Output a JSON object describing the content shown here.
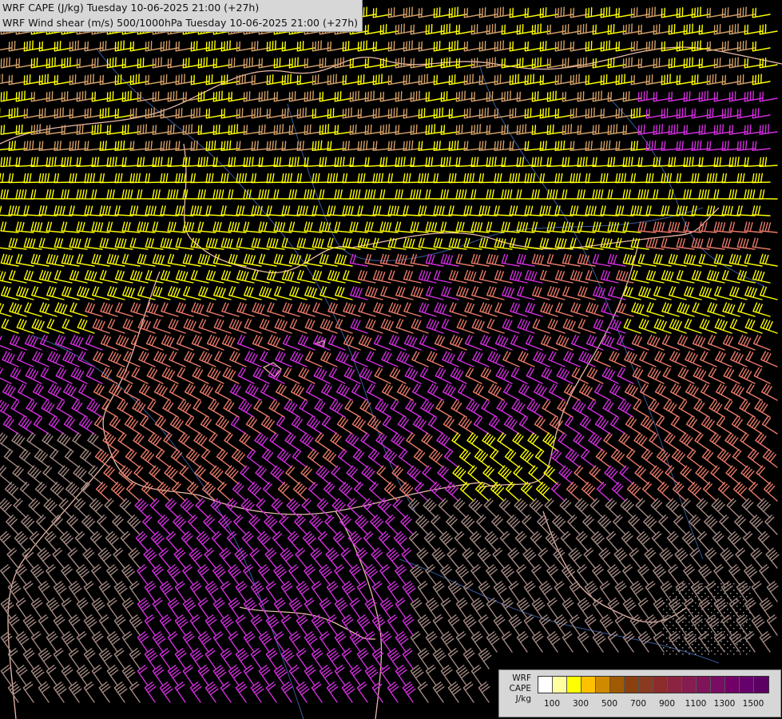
{
  "header": {
    "line1": "WRF CAPE (J/kg) Tuesday 10-06-2025 21:00 (+27h)",
    "line2": "WRF Wind shear (m/s) 500/1000hPa Tuesday 10-06-2025 21:00 (+27h)"
  },
  "legend": {
    "title_line1": "WRF",
    "title_line2": "CAPE",
    "unit": "J/kg",
    "tick_labels": [
      "100",
      "300",
      "500",
      "700",
      "900",
      "1100",
      "1300",
      "1500"
    ],
    "colors": [
      "#ffffff",
      "#ffffa0",
      "#ffff00",
      "#ffc000",
      "#d08a00",
      "#a05a00",
      "#8b4010",
      "#8a3a20",
      "#8c2c2c",
      "#8a2440",
      "#861c50",
      "#80145a",
      "#7a0c64",
      "#720068",
      "#66006a",
      "#5c0064"
    ]
  },
  "map_layers": {
    "barb_colors": {
      "low_cape": "#a58a83",
      "tan": "#d4a066",
      "yellow": "#ffff00",
      "salmon": "#ec7a6a",
      "magenta": "#d52ee0"
    },
    "border_color": "#e8b8a8",
    "river_color": "#3a5a9a",
    "background": "#000000"
  }
}
